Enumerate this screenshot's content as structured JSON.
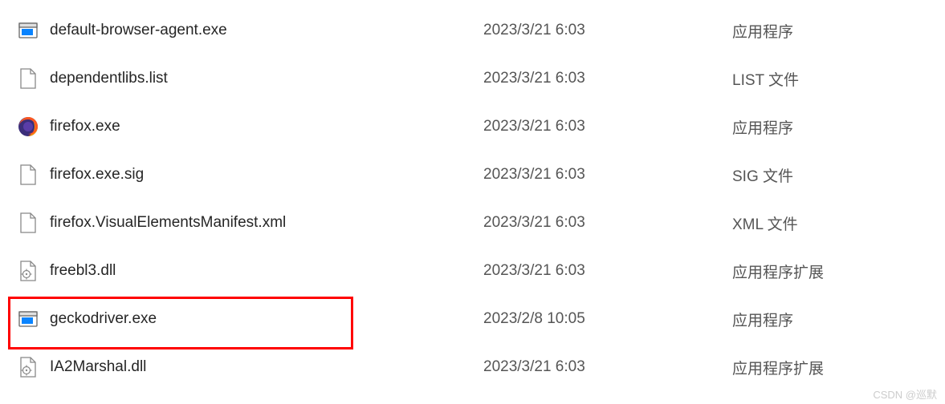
{
  "files": [
    {
      "name": "default-browser-agent.exe",
      "date": "2023/3/21 6:03",
      "type": "应用程序",
      "icon": "exe"
    },
    {
      "name": "dependentlibs.list",
      "date": "2023/3/21 6:03",
      "type": "LIST 文件",
      "icon": "blank"
    },
    {
      "name": "firefox.exe",
      "date": "2023/3/21 6:03",
      "type": "应用程序",
      "icon": "firefox"
    },
    {
      "name": "firefox.exe.sig",
      "date": "2023/3/21 6:03",
      "type": "SIG 文件",
      "icon": "blank"
    },
    {
      "name": "firefox.VisualElementsManifest.xml",
      "date": "2023/3/21 6:03",
      "type": "XML 文件",
      "icon": "blank"
    },
    {
      "name": "freebl3.dll",
      "date": "2023/3/21 6:03",
      "type": "应用程序扩展",
      "icon": "dll"
    },
    {
      "name": "geckodriver.exe",
      "date": "2023/2/8 10:05",
      "type": "应用程序",
      "icon": "exe",
      "highlighted": true
    },
    {
      "name": "IA2Marshal.dll",
      "date": "2023/3/21 6:03",
      "type": "应用程序扩展",
      "icon": "dll"
    }
  ],
  "watermark": "CSDN @巡默"
}
